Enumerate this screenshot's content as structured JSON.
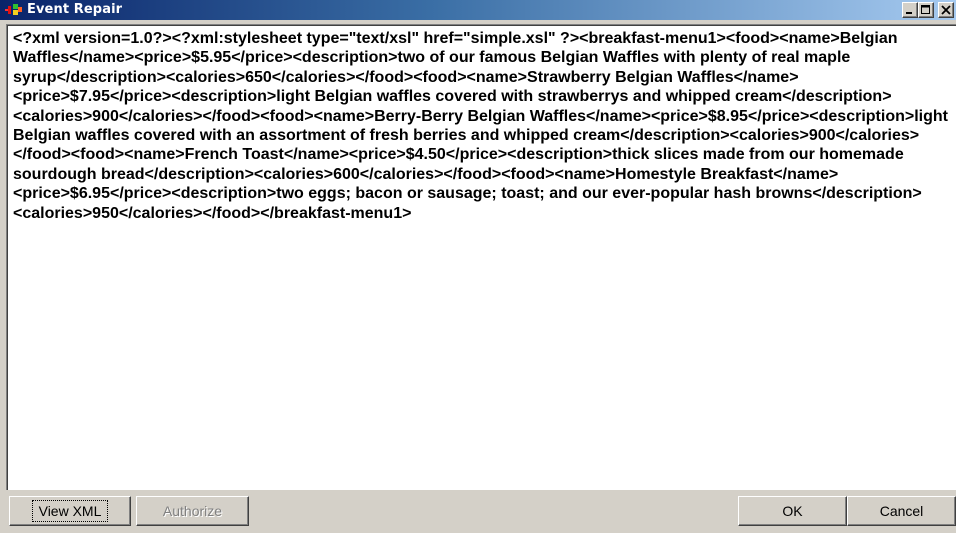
{
  "window": {
    "title": "Event Repair",
    "icon": "event-repair-app-icon"
  },
  "titlebar_controls": {
    "minimize_icon": "minimize-icon",
    "maximize_icon": "maximize-icon",
    "close_icon": "close-icon"
  },
  "content": {
    "xml_text": "<?xml version=1.0?><?xml:stylesheet type=\"text/xsl\" href=\"simple.xsl\" ?><breakfast-menu1><food><name>Belgian Waffles</name><price>$5.95</price><description>two of our famous Belgian Waffles with plenty of real maple syrup</description><calories>650</calories></food><food><name>Strawberry Belgian Waffles</name><price>$7.95</price><description>light Belgian waffles covered with strawberrys and whipped cream</description><calories>900</calories></food><food><name>Berry-Berry Belgian Waffles</name><price>$8.95</price><description>light Belgian waffles covered with an assortment of fresh berries and whipped cream</description><calories>900</calories></food><food><name>French Toast</name><price>$4.50</price><description>thick slices made from our homemade sourdough bread</description><calories>600</calories></food><food><name>Homestyle Breakfast</name><price>$6.95</price><description>two eggs; bacon or sausage; toast; and our ever-popular hash browns</description><calories>950</calories></food></breakfast-menu1>"
  },
  "buttons": {
    "view_xml": "View XML",
    "authorize": "Authorize",
    "ok": "OK",
    "cancel": "Cancel"
  },
  "colors": {
    "titlebar_start": "#0a246a",
    "titlebar_end": "#a6caf0",
    "face": "#d4d0c8",
    "disabled_text": "#808080"
  }
}
